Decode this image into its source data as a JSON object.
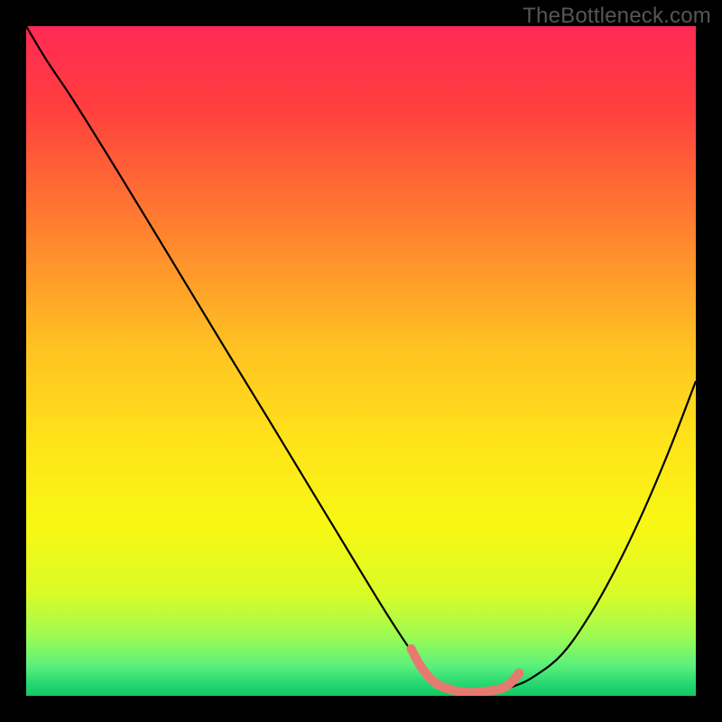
{
  "watermark": "TheBottleneck.com",
  "chart_data": {
    "type": "line",
    "title": "",
    "xlabel": "",
    "ylabel": "",
    "xlim": [
      0,
      100
    ],
    "ylim": [
      0,
      100
    ],
    "background_gradient": {
      "stops": [
        {
          "offset": 0.0,
          "color": "#ff2a55"
        },
        {
          "offset": 0.12,
          "color": "#ff3e3e"
        },
        {
          "offset": 0.3,
          "color": "#ff802f"
        },
        {
          "offset": 0.48,
          "color": "#ffc222"
        },
        {
          "offset": 0.62,
          "color": "#ffe31a"
        },
        {
          "offset": 0.75,
          "color": "#f7f813"
        },
        {
          "offset": 0.85,
          "color": "#d8fb28"
        },
        {
          "offset": 0.91,
          "color": "#9efb52"
        },
        {
          "offset": 0.955,
          "color": "#5bf07c"
        },
        {
          "offset": 0.985,
          "color": "#21d56f"
        },
        {
          "offset": 1.0,
          "color": "#14c761"
        }
      ]
    },
    "series": [
      {
        "name": "bottleneck-curve",
        "color": "#000000",
        "width": 2.2,
        "x": [
          0.0,
          3.0,
          7.0,
          12.0,
          18.0,
          24.0,
          30.0,
          36.0,
          42.0,
          48.0,
          54.0,
          58.0,
          61.0,
          63.0,
          66.0,
          70.0,
          73.0,
          76.0,
          80.0,
          84.0,
          88.0,
          92.0,
          96.0,
          100.0
        ],
        "y": [
          100.0,
          95.0,
          89.0,
          81.0,
          71.2,
          61.3,
          51.4,
          41.6,
          31.7,
          21.8,
          12.0,
          6.0,
          2.4,
          0.9,
          0.5,
          0.7,
          1.5,
          3.0,
          6.2,
          11.8,
          18.9,
          27.2,
          36.6,
          47.0
        ]
      },
      {
        "name": "optimal-zone-marker",
        "color": "#e77a70",
        "width": 10.0,
        "linecap": "round",
        "x": [
          57.5,
          59.0,
          61.0,
          63.5,
          66.0,
          68.5,
          71.0,
          72.4,
          73.6
        ],
        "y": [
          7.0,
          4.3,
          2.0,
          0.9,
          0.5,
          0.65,
          1.1,
          2.0,
          3.4
        ]
      }
    ],
    "dots": {
      "color": "#e77a70",
      "radius": 5.2,
      "points": [
        {
          "x": 57.5,
          "y": 7.0
        },
        {
          "x": 73.6,
          "y": 3.4
        }
      ]
    }
  }
}
